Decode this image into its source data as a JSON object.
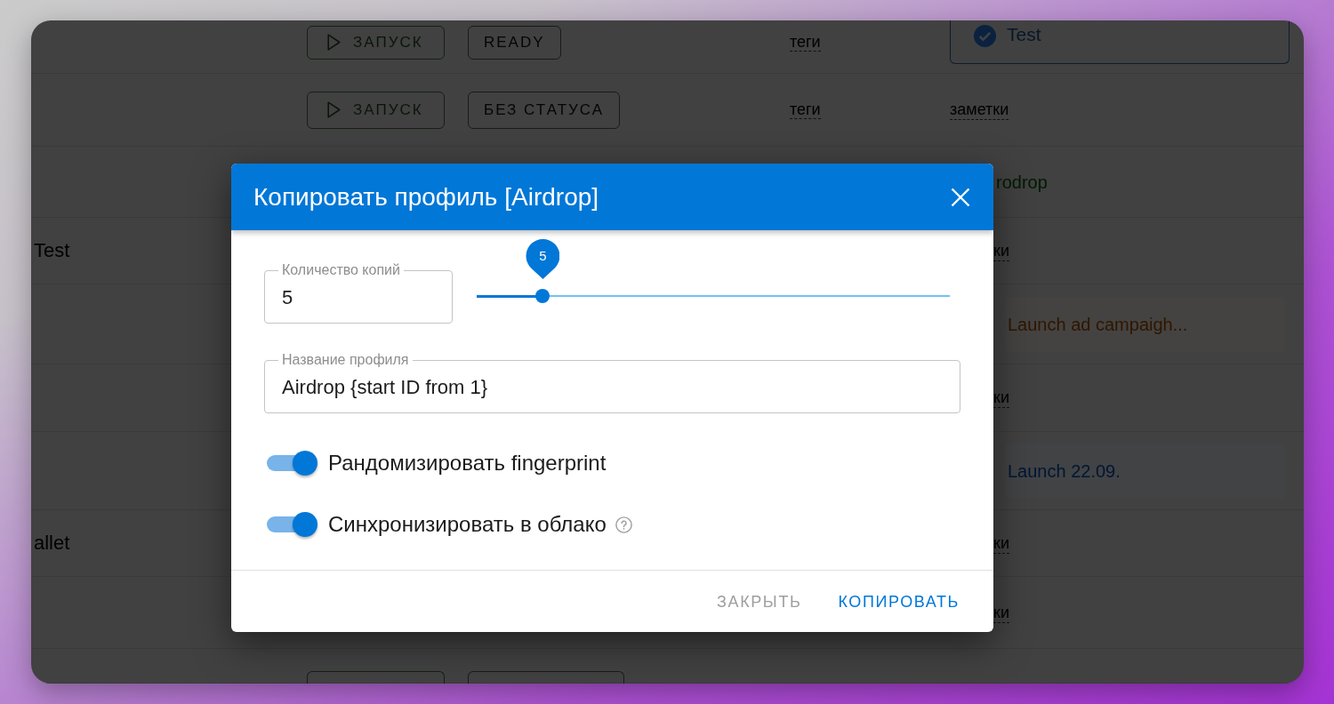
{
  "background_table": {
    "rows": [
      {
        "kind": "row",
        "launch": "ЗАПУСК",
        "status": "READY",
        "tags": "теги",
        "note": {
          "kind": "chip",
          "text": "Test",
          "checked": true
        }
      },
      {
        "kind": "row",
        "launch": "ЗАПУСК",
        "status": "БЕЗ СТАТУСА",
        "tags": "теги",
        "note": {
          "kind": "link",
          "text": "заметки"
        }
      },
      {
        "kind": "row",
        "note": {
          "kind": "label",
          "text": "rodrop",
          "color": "#001a00"
        }
      },
      {
        "kind": "row",
        "name": "Test",
        "note": {
          "kind": "partial",
          "text": "ки"
        }
      },
      {
        "kind": "row",
        "note": {
          "kind": "tag",
          "text": "Launch ad campaigh...",
          "color": "#2e1600"
        }
      },
      {
        "kind": "row",
        "note": {
          "kind": "partial",
          "text": "ки"
        }
      },
      {
        "kind": "row",
        "note": {
          "kind": "tag",
          "text": "Launch 22.09.",
          "color": "#001633"
        }
      },
      {
        "kind": "row",
        "name": "allet",
        "note": {
          "kind": "partial",
          "text": "ки"
        }
      },
      {
        "kind": "row",
        "note": {
          "kind": "partial",
          "text": "ки"
        }
      },
      {
        "kind": "cut"
      }
    ]
  },
  "dialog": {
    "title": "Копировать профиль [Airdrop]",
    "copies_field": {
      "label": "Количество копий",
      "value": "5"
    },
    "copies_slider": {
      "value_label": "5",
      "level": 0.14
    },
    "name_field": {
      "label": "Название профиля",
      "value": "Airdrop {start ID from 1}"
    },
    "switches": [
      {
        "label": "Рандомизировать fingerprint",
        "on": true,
        "help": false
      },
      {
        "label": "Синхронизировать в облако",
        "on": true,
        "help": true
      }
    ],
    "buttons": [
      {
        "label": "ЗАКРЫТЬ",
        "kind": "secondary"
      },
      {
        "label": "КОПИРОВАТЬ",
        "kind": "primary"
      }
    ]
  }
}
